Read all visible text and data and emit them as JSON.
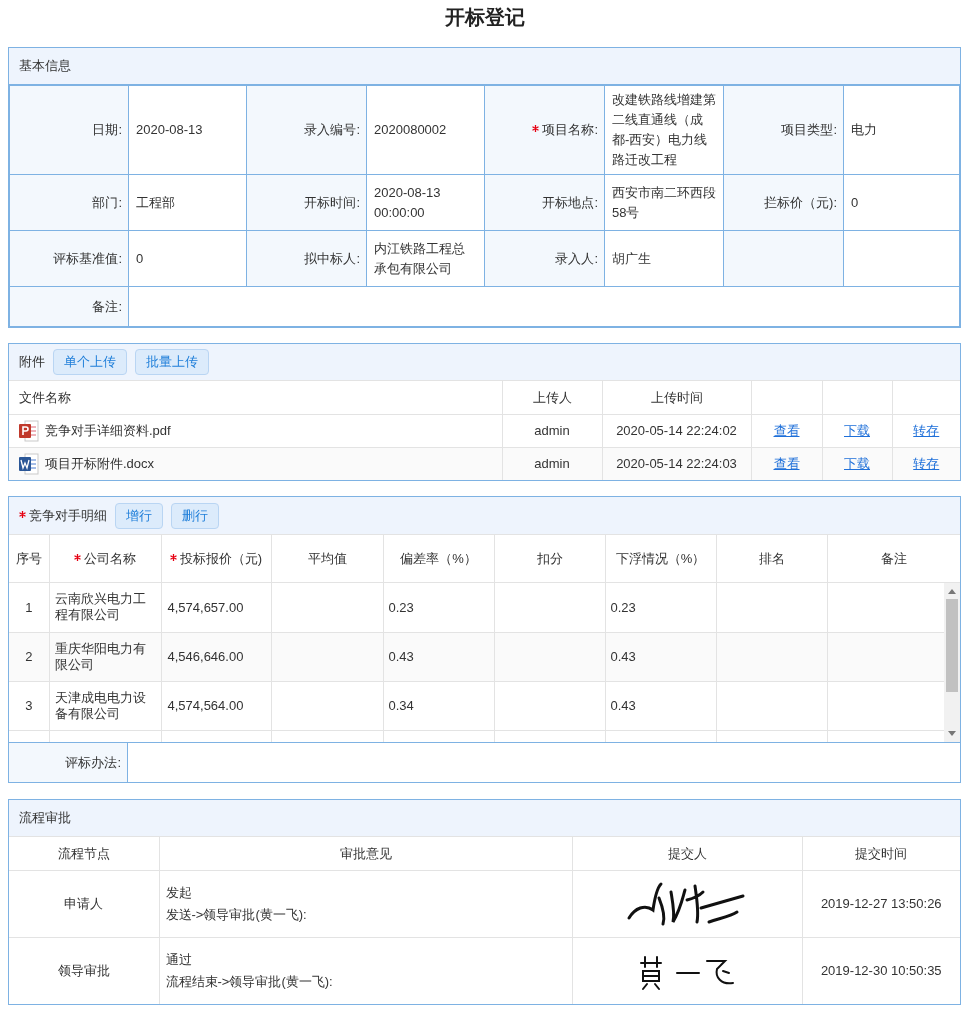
{
  "title": "开标登记",
  "basic_info": {
    "title": "基本信息",
    "fields": [
      {
        "label": "日期:",
        "value": "2020-08-13",
        "required": false
      },
      {
        "label": "录入编号:",
        "value": "2020080002",
        "required": false
      },
      {
        "label": "项目名称:",
        "value": "改建铁路线增建第二线直通线（成都-西安）电力线路迁改工程",
        "required": true
      },
      {
        "label": "项目类型:",
        "value": "电力",
        "required": false
      },
      {
        "label": "部门:",
        "value": "工程部",
        "required": false
      },
      {
        "label": "开标时间:",
        "value": "2020-08-13 00:00:00",
        "required": false
      },
      {
        "label": "开标地点:",
        "value": "西安市南二环西段58号",
        "required": false
      },
      {
        "label": "拦标价（元):",
        "value": "0",
        "required": false
      },
      {
        "label": "评标基准值:",
        "value": "0",
        "required": false
      },
      {
        "label": "拟中标人:",
        "value": "内江铁路工程总承包有限公司",
        "required": false
      },
      {
        "label": "录入人:",
        "value": "胡广生",
        "required": false
      }
    ],
    "remarks_label": "备注:"
  },
  "attachments": {
    "title": "附件",
    "buttons": [
      "单个上传",
      "批量上传"
    ],
    "columns": [
      "文件名称",
      "上传人",
      "上传时间"
    ],
    "rows": [
      {
        "kind": "pdf",
        "name": "竞争对手详细资料.pdf",
        "uploader": "admin",
        "time": "2020-05-14 22:24:02",
        "actions": [
          "查看",
          "下载",
          "转存"
        ]
      },
      {
        "kind": "word",
        "name": "项目开标附件.docx",
        "uploader": "admin",
        "time": "2020-05-14 22:24:03",
        "actions": [
          "查看",
          "下载",
          "转存"
        ]
      }
    ]
  },
  "competitors": {
    "title": "竞争对手明细",
    "required": true,
    "buttons": [
      "增行",
      "删行"
    ],
    "columns": [
      {
        "label": "序号",
        "required": false
      },
      {
        "label": "公司名称",
        "required": true
      },
      {
        "label": "投标报价（元)",
        "required": true
      },
      {
        "label": "平均值",
        "required": false
      },
      {
        "label": "偏差率（%）",
        "required": false
      },
      {
        "label": "扣分",
        "required": false
      },
      {
        "label": "下浮情况（%）",
        "required": false
      },
      {
        "label": "排名",
        "required": false
      },
      {
        "label": "备注",
        "required": false
      }
    ],
    "rows": [
      {
        "no": "1",
        "company": "云南欣兴电力工程有限公司",
        "price": "4,574,657.00",
        "deviation": "0.23",
        "float": "0.23"
      },
      {
        "no": "2",
        "company": "重庆华阳电力有限公司",
        "price": "4,546,646.00",
        "deviation": "0.43",
        "float": "0.43"
      },
      {
        "no": "3",
        "company": "天津成电电力设备有限公司",
        "price": "4,574,564.00",
        "deviation": "0.34",
        "float": "0.43"
      }
    ],
    "method_label": "评标办法:"
  },
  "approval": {
    "title": "流程审批",
    "columns": [
      "流程节点",
      "审批意见",
      "提交人",
      "提交时间"
    ],
    "rows": [
      {
        "node": "申请人",
        "opinion": [
          "发起",
          "发送->领导审批(黄一飞):"
        ],
        "time": "2019-12-27 13:50:26"
      },
      {
        "node": "领导审批",
        "opinion": [
          "通过",
          "流程结束->领导审批(黄一飞):"
        ],
        "time": "2019-12-30 10:50:35"
      }
    ]
  }
}
